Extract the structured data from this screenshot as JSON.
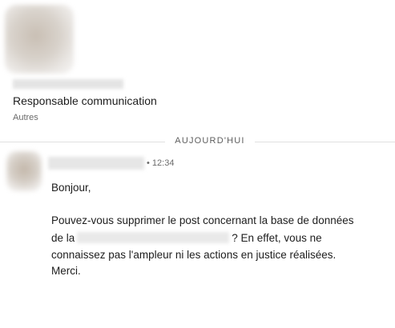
{
  "profile": {
    "name": "",
    "headline": "Responsable communication",
    "category": "Autres"
  },
  "divider": {
    "label": "AUJOURD'HUI"
  },
  "message": {
    "sender": "",
    "timestamp": "• 12:34",
    "greeting": "Bonjour,",
    "line1": "Pouvez-vous supprimer le post concernant la base de données",
    "line2_prefix": "de la",
    "line2_suffix": "? En effet, vous ne",
    "line3": "connaissez pas l'ampleur ni les actions en justice réalisées.",
    "line4": "Merci."
  }
}
